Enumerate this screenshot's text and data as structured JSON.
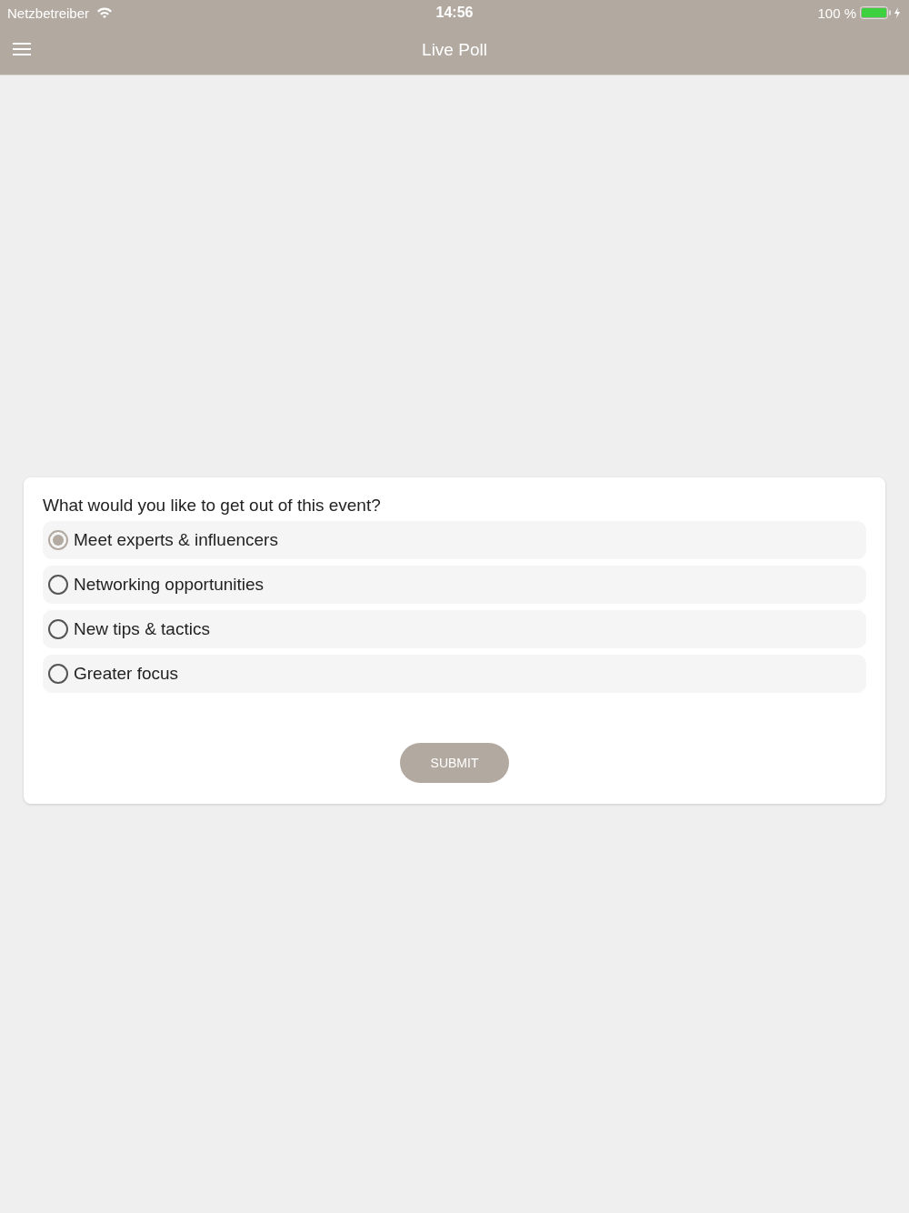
{
  "status_bar": {
    "carrier": "Netzbetreiber",
    "time": "14:56",
    "battery": "100 %"
  },
  "nav_bar": {
    "title": "Live Poll"
  },
  "poll": {
    "question": "What would you like to get out of this event?",
    "options": [
      {
        "label": "Meet experts & influencers",
        "selected": true
      },
      {
        "label": "Networking opportunities",
        "selected": false
      },
      {
        "label": "New tips & tactics",
        "selected": false
      },
      {
        "label": "Greater focus",
        "selected": false
      }
    ],
    "submit": "SUBMIT"
  }
}
